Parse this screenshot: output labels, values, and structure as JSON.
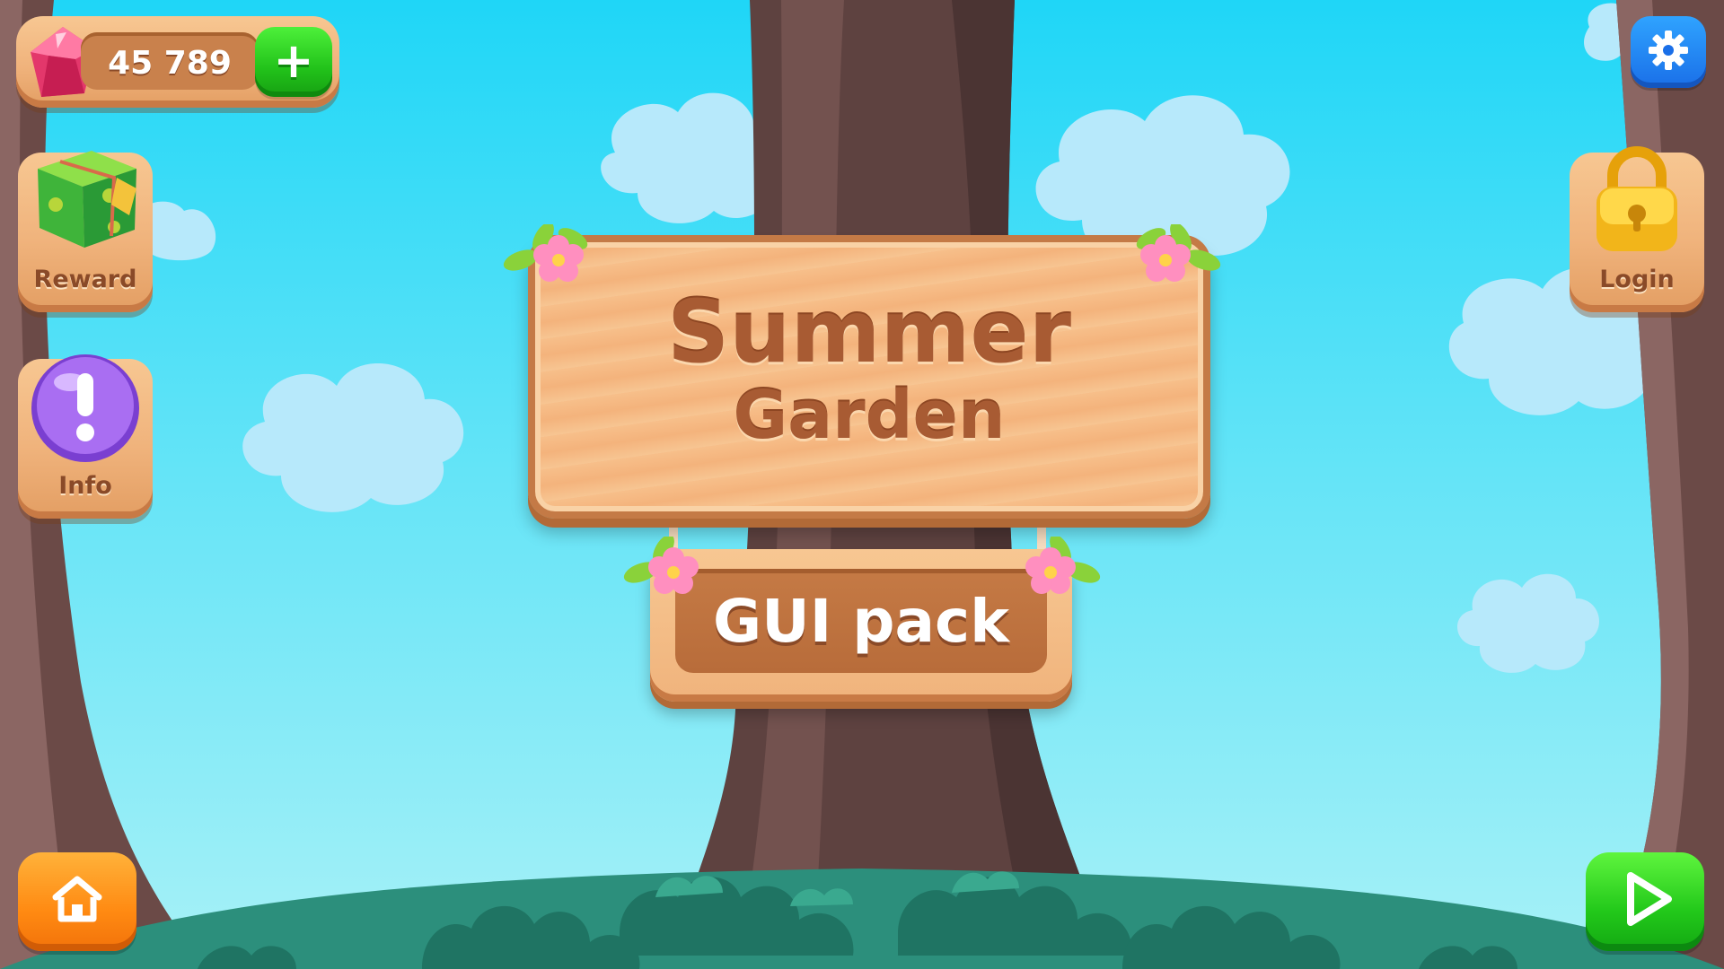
{
  "currency": {
    "value": "45 789",
    "add_label": "+",
    "icon": "gem-icon"
  },
  "left_menu": {
    "reward": {
      "label": "Reward",
      "icon": "gift-box-icon"
    },
    "info": {
      "label": "Info",
      "icon": "exclamation-icon"
    }
  },
  "right_menu": {
    "login": {
      "label": "Login",
      "icon": "padlock-icon"
    },
    "settings": {
      "icon": "gear-icon"
    }
  },
  "bottom_bar": {
    "home": {
      "icon": "home-icon"
    },
    "play": {
      "icon": "play-icon"
    }
  },
  "title_sign": {
    "line1": "Summer",
    "line2": "Garden"
  },
  "subtitle_sign": {
    "text": "GUI pack"
  },
  "colors": {
    "sky": "#1fd6f7",
    "wood": "#f0b37c",
    "wood_dark": "#c47a46",
    "green_button": "#22c21a",
    "orange_button": "#ff8a12",
    "blue_button": "#1a6fe8"
  }
}
